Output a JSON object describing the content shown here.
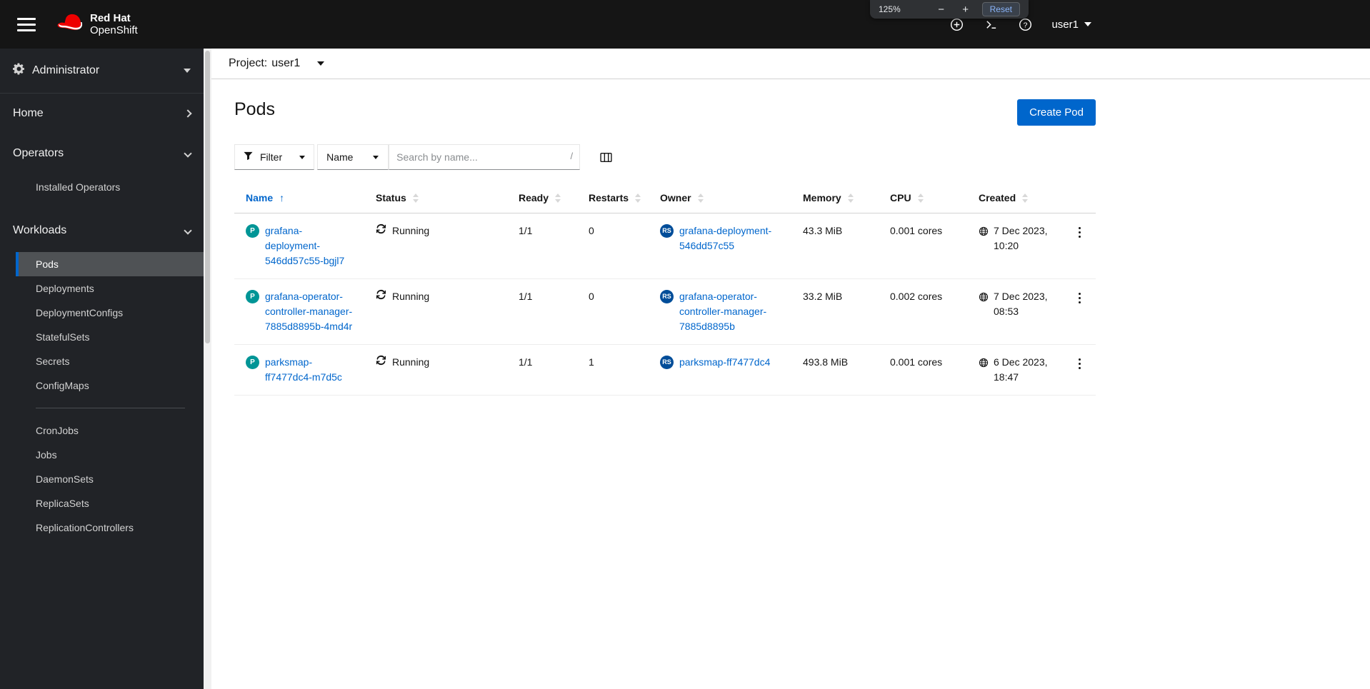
{
  "masthead": {
    "brand": {
      "line1": "Red Hat",
      "line2": "OpenShift"
    },
    "username": "user1"
  },
  "zoom_overlay": {
    "level": "125%",
    "minus": "−",
    "plus": "+",
    "reset": "Reset"
  },
  "sidebar": {
    "perspective": "Administrator",
    "groups": {
      "home": "Home",
      "operators": "Operators",
      "workloads": "Workloads"
    },
    "operators_items": [
      "Installed Operators"
    ],
    "workloads_items_top": [
      "Pods",
      "Deployments",
      "DeploymentConfigs",
      "StatefulSets",
      "Secrets",
      "ConfigMaps"
    ],
    "workloads_items_bottom": [
      "CronJobs",
      "Jobs",
      "DaemonSets",
      "ReplicaSets",
      "ReplicationControllers"
    ],
    "selected_item": "Pods"
  },
  "project_bar": {
    "label": "Project:",
    "value": "user1"
  },
  "page_header": {
    "title": "Pods",
    "create_button": "Create Pod"
  },
  "toolbar": {
    "filter": "Filter",
    "attribute": "Name",
    "search_placeholder": "Search by name...",
    "shortcut": "/"
  },
  "table": {
    "columns": {
      "name": "Name",
      "status": "Status",
      "ready": "Ready",
      "restarts": "Restarts",
      "owner": "Owner",
      "memory": "Memory",
      "cpu": "CPU",
      "created": "Created"
    },
    "sort": {
      "column": "Name",
      "direction": "ascending"
    },
    "rows": [
      {
        "badge": "P",
        "name": "grafana-deployment-546dd57c55-bgjl7",
        "status": "Running",
        "ready": "1/1",
        "restarts": "0",
        "owner_badge": "RS",
        "owner": "grafana-deployment-546dd57c55",
        "memory": "43.3 MiB",
        "cpu": "0.001 cores",
        "created": "7 Dec 2023, 10:20"
      },
      {
        "badge": "P",
        "name": "grafana-operator-controller-manager-7885d8895b-4md4r",
        "status": "Running",
        "ready": "1/1",
        "restarts": "0",
        "owner_badge": "RS",
        "owner": "grafana-operator-controller-manager-7885d8895b",
        "memory": "33.2 MiB",
        "cpu": "0.002 cores",
        "created": "7 Dec 2023, 08:53"
      },
      {
        "badge": "P",
        "name": "parksmap-ff7477dc4-m7d5c",
        "status": "Running",
        "ready": "1/1",
        "restarts": "1",
        "owner_badge": "RS",
        "owner": "parksmap-ff7477dc4",
        "memory": "493.8 MiB",
        "cpu": "0.001 cores",
        "created": "6 Dec 2023, 18:47"
      }
    ]
  },
  "icons": {
    "running_status": "sync-icon",
    "timestamp": "globe-icon",
    "filter": "funnel-icon",
    "column_management": "columns-icon",
    "row_actions": "kebab-icon"
  },
  "colors": {
    "accent": "#0066cc",
    "masthead_bg": "#151515",
    "sidebar_bg": "#212327",
    "nav_selected_bg": "#4f5255",
    "pod_badge": "#009596",
    "replicaset_badge": "#004d99",
    "brand_red": "#ee0000"
  }
}
